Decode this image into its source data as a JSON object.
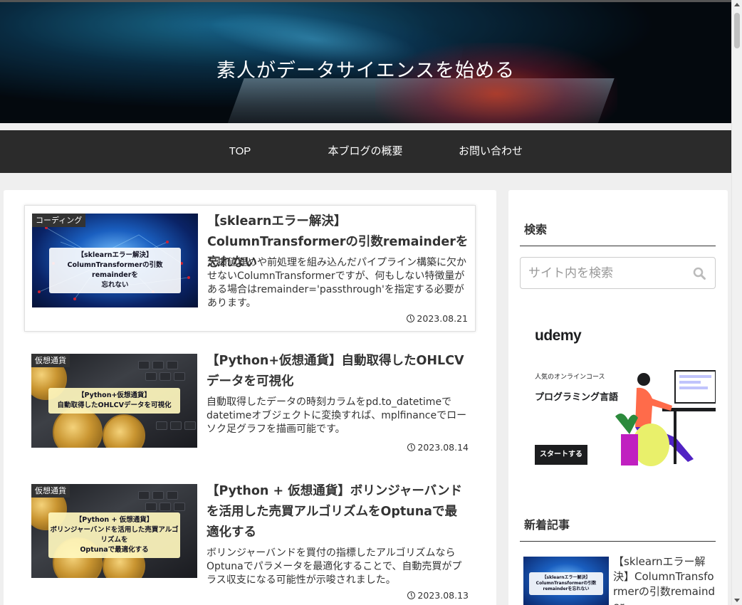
{
  "site": {
    "title": "素人がデータサイエンスを始める"
  },
  "nav": {
    "items": [
      {
        "label": "TOP"
      },
      {
        "label": "本ブログの概要"
      },
      {
        "label": "お問い合わせ"
      }
    ]
  },
  "articles": [
    {
      "category": "コーディング",
      "title": "【sklearnエラー解決】ColumnTransformerの引数remainderを忘れない",
      "thumb_text": "【sklearnエラー解決】\nColumnTransformerの引数remainderを\n忘れない",
      "snippet": "欠損値埋めや前処理を組み込んだパイプライン構築に欠かせないColumnTransformerですが、何もしない特徴量がある場合はremainder='passthrough'を指定する必要があります。",
      "date": "2023.08.21"
    },
    {
      "category": "仮想通貨",
      "title": "【Python+仮想通貨】自動取得したOHLCVデータを可視化",
      "thumb_text": "【Python+仮想通貨】\n自動取得したOHLCVデータを可視化",
      "snippet": "自動取得したデータの時刻カラムをpd.to_datetimeでdatetimeオブジェクトに変換すれば、mplfinanceでローソク足グラフを描画可能です。",
      "date": "2023.08.14"
    },
    {
      "category": "仮想通貨",
      "title": "【Python + 仮想通貨】ボリンジャーバンドを活用した売買アルゴリズムをOptunaで最適化する",
      "thumb_text": "【Python + 仮想通貨】\nボリンジャーバンドを活用した売買アルゴリズムを\nOptunaで最適化する",
      "snippet": "ボリンジャーバンドを買付の指標したアルゴリズムならOptunaでパラメータを最適化することで、自動売買がプラス収支になる可能性が示唆されました。",
      "date": "2023.08.13"
    }
  ],
  "sidebar": {
    "search_heading": "検索",
    "search_placeholder": "サイト内を検索",
    "ad": {
      "brand": "udemy",
      "small": "人気のオンラインコース",
      "big": "プログラミング言語",
      "button": "スタートする"
    },
    "recent_heading": "新着記事",
    "recent": [
      {
        "title": "【sklearnエラー解決】ColumnTransformerの引数remainder",
        "thumb_text": "【sklearnエラー解決】ColumnTransformerの引数remainderを忘れない"
      }
    ]
  },
  "colors": {
    "nav_bg": "#2b2b2b",
    "category_bg": "#333333",
    "page_bg": "#efefef"
  },
  "icons": {
    "search": "search-icon",
    "date": "clock-icon"
  }
}
